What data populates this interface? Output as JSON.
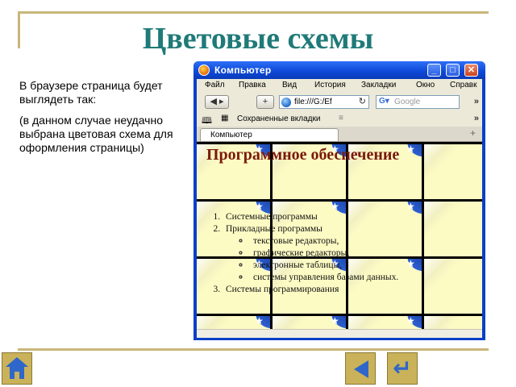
{
  "slide": {
    "title": "Цветовые схемы",
    "description": "В браузере страница будет выглядеть так:",
    "note": "(в данном случае неудачно выбрана цветовая схема для оформления страницы)"
  },
  "browser": {
    "window_title": "Компьютер",
    "menu": [
      "Файл",
      "Правка",
      "Вид",
      "История",
      "Закладки",
      "Окно",
      "Справк"
    ],
    "address": "file:///G:/Ef",
    "search_placeholder": "Google",
    "bookmarks_label": "Сохраненные вкладки",
    "tab_label": "Компьютер"
  },
  "page": {
    "heading": "Программное обеспечение",
    "list": [
      {
        "text": "Системные программы"
      },
      {
        "text": "Прикладные программы",
        "sub": [
          "текстовые редакторы,",
          "графические редакторы,",
          "электронные таблицы,",
          "системы управления базами данных."
        ]
      },
      {
        "text": "Системы программирования"
      }
    ]
  },
  "colors": {
    "title": "#1f7a78",
    "heading": "#7a1a0a",
    "tile_light": "#fdfbc4",
    "tile_blue": "#2c5fd0",
    "nav_button": "#c9b25a"
  },
  "icons": {
    "home": "home-icon",
    "back": "arrow-left-icon",
    "return": "return-icon"
  }
}
